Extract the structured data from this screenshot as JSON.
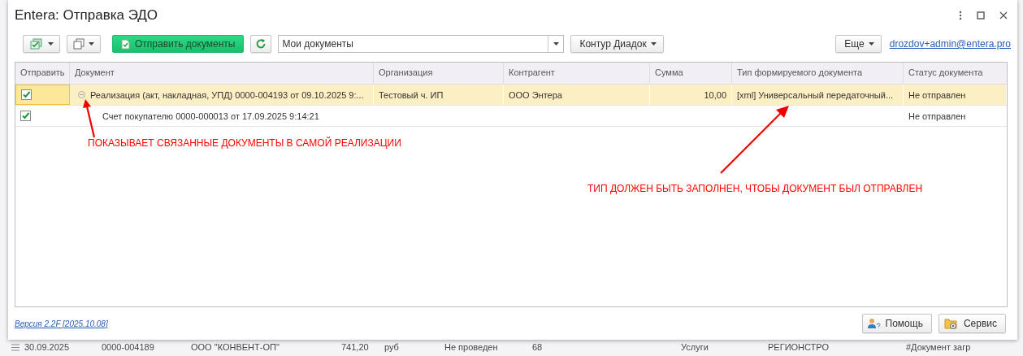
{
  "window": {
    "title": "Entera: Отправка ЭДО"
  },
  "toolbar": {
    "send_button": "Отправить документы",
    "filter": {
      "value": "Мои документы"
    },
    "provider_button": "Контур Диадок",
    "more_button": "Еще",
    "user_link": "drozdov+admin@entera.pro"
  },
  "table": {
    "columns": [
      "Отправить",
      "Документ",
      "Организация",
      "Контрагент",
      "Сумма",
      "Тип формируемого документа",
      "Статус документа"
    ],
    "rows": [
      {
        "checked": true,
        "selected": true,
        "expanded": true,
        "document": "Реализация (акт, накладная, УПД) 0000-004193 от 09.10.2025 9:...",
        "organization": "Тестовый ч. ИП",
        "counterparty": "ООО Энтера",
        "amount": "10,00",
        "doc_type": "[xml] Универсальный передаточный...",
        "status": "Не отправлен",
        "children": [
          {
            "checked": true,
            "selected": false,
            "document": "Счет покупателю 0000-000013 от 17.09.2025 9:14:21",
            "status": "Не отправлен"
          }
        ]
      }
    ]
  },
  "annotations": [
    {
      "text": "ПОКАЗЫВАЕТ СВЯЗАННЫЕ ДОКУМЕНТЫ В САМОЙ РЕАЛИЗАЦИИ"
    },
    {
      "text": "ТИП ДОЛЖЕН БЫТЬ ЗАПОЛНЕН, ЧТОБЫ ДОКУМЕНТ БЫЛ ОТПРАВЛЕН"
    }
  ],
  "footer": {
    "version_link": "Версия 2.2F [2025.10.08]",
    "help_button": "Помощь",
    "service_button": "Сервис"
  },
  "background_row": {
    "cells": [
      "30.09.2025",
      "0000-004189",
      "ООО \"КОНВЕНТ-ОП\"",
      "741,20",
      "руб",
      "Не проведен",
      "68",
      "Услуги",
      "РЕГИОНСТРО",
      "#Документ загр"
    ]
  }
}
